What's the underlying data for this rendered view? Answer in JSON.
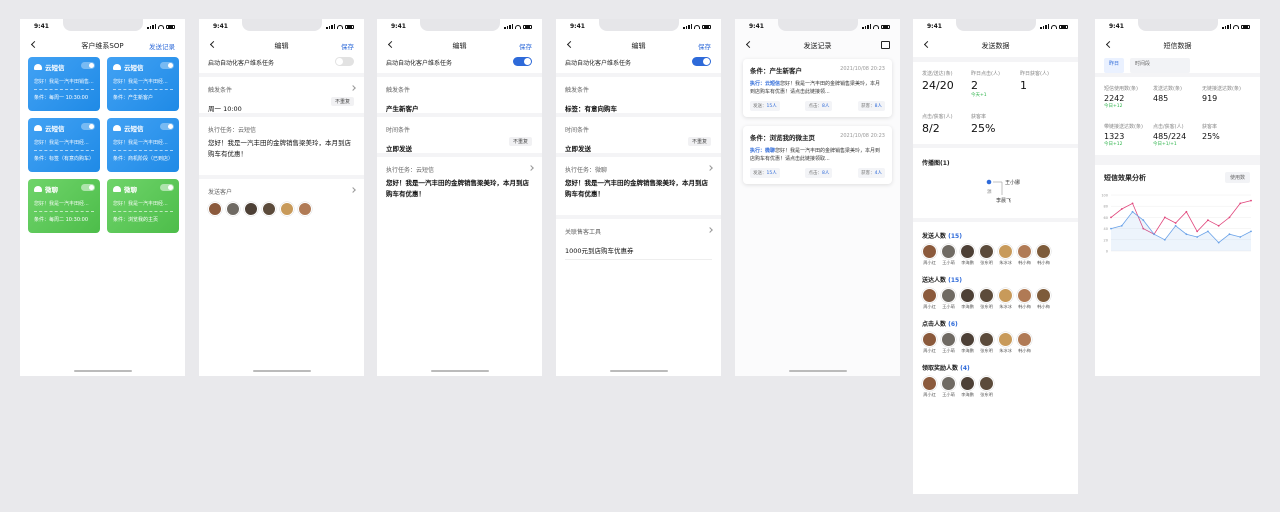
{
  "status": {
    "time": "9:41"
  },
  "s1": {
    "title": "客户维系SOP",
    "right": "发送记录",
    "cards": [
      {
        "name": "云短信",
        "sub": "您好！我是一汽丰田销售...",
        "cond": "条件：每周一 10:30:00",
        "color": "blue",
        "on": false
      },
      {
        "name": "云短信",
        "sub": "您好！我是一汽丰田经...",
        "cond": "条件：产生新客户",
        "color": "blue",
        "on": false
      },
      {
        "name": "云短信",
        "sub": "您好！我是一汽丰田经...",
        "cond": "条件：标签（有意向购车）",
        "color": "blue",
        "on": false
      },
      {
        "name": "云短信",
        "sub": "您好！我是一汽丰田经...",
        "cond": "条件：商机阶段（已到店）",
        "color": "blue",
        "on": false
      },
      {
        "name": "微聊",
        "sub": "您好！我是一汽丰田经...",
        "cond": "条件：每周二 10:30:00",
        "color": "green",
        "on": true
      },
      {
        "name": "微聊",
        "sub": "您好！我是一汽丰田经...",
        "cond": "条件：浏览我的主页",
        "color": "green",
        "on": true
      }
    ]
  },
  "s2": {
    "title": "编辑",
    "save": "保存",
    "toggle_label": "启动自动化客户维系任务",
    "trigger_label": "触发条件",
    "trigger_val": "周一 10:00",
    "repeat": "不重复",
    "task_label": "执行任务：云短信",
    "task_text": "您好！我是一汽丰田的金牌销售梁美玲，本月到店购车有优惠！",
    "cust_label": "发送客户"
  },
  "s3": {
    "title": "编辑",
    "save": "保存",
    "toggle_label": "启动自动化客户维系任务",
    "trigger_label": "触发条件",
    "trigger_val": "产生新客户",
    "time_label": "时间条件",
    "time_val": "立即发送",
    "repeat": "不重复",
    "task_label": "执行任务：云短信",
    "task_text": "您好！我是一汽丰田的金牌销售梁美玲，本月到店购车有优惠！"
  },
  "s4": {
    "title": "编辑",
    "save": "保存",
    "toggle_label": "启动自动化客户维系任务",
    "trigger_label": "触发条件",
    "trigger_val": "标签：有意向购车",
    "time_label": "时间条件",
    "time_val": "立即发送",
    "repeat": "不重复",
    "task_label": "执行任务：微聊",
    "task_text": "您好！我是一汽丰田的金牌销售梁美玲，本月到店购车有优惠！",
    "tool_label": "关联售客工具",
    "tool_val": "1000元到店购车优惠券"
  },
  "s5": {
    "title": "发送记录",
    "records": [
      {
        "title": "条件：产生新客户",
        "time": "2021/10/08 20:23",
        "exec": "执行：",
        "channel": "云短信",
        "body": "您好！我是一汽丰田的金牌销售梁美玲，本月到店购车有优惠！请点击此链接领...",
        "s1": "发送：",
        "v1": "15人",
        "s2": "点击：",
        "v2": "8人",
        "s3": "获客：",
        "v3": "8人"
      },
      {
        "title": "条件：浏览我的微主页",
        "time": "2021/10/08 20:23",
        "exec": "执行：",
        "channel": "微聊",
        "body": "您好！我是一汽丰田的金牌销售梁美玲，本月到店购车有优惠！请点击此链接领取...",
        "s1": "发送：",
        "v1": "15人",
        "s2": "点击：",
        "v2": "8人",
        "s3": "获客：",
        "v3": "4人"
      }
    ]
  },
  "s6": {
    "title": "发送数据",
    "stats": [
      {
        "label": "发送/送达(条)",
        "value": "24/20",
        "inc": ""
      },
      {
        "label": "昨日点击(人)",
        "value": "2",
        "inc": "今天+1"
      },
      {
        "label": "昨日获客(人)",
        "value": "1",
        "inc": ""
      },
      {
        "label": "点击/获客(人)",
        "value": "8/2",
        "inc": ""
      },
      {
        "label": "获客率",
        "value": "25%",
        "inc": ""
      }
    ],
    "spread_title": "传播图(1)",
    "spread_a": "王小娜",
    "spread_src": "源",
    "spread_b": "李晨飞",
    "groups": [
      {
        "title": "发送人数",
        "count": "(15)",
        "people": [
          "周小红",
          "王小萌",
          "李海鹏",
          "张东明",
          "朱冰冰",
          "韩小梅",
          "韩小梅"
        ]
      },
      {
        "title": "送达人数",
        "count": "(15)",
        "people": [
          "周小红",
          "王小萌",
          "李海鹏",
          "张东明",
          "朱冰冰",
          "韩小梅",
          "韩小梅"
        ]
      },
      {
        "title": "点击人数",
        "count": "(6)",
        "people": [
          "周小红",
          "王小萌",
          "李海鹏",
          "张东明",
          "朱冰冰",
          "韩小梅"
        ]
      },
      {
        "title": "领取奖励人数",
        "count": "(4)",
        "people": [
          "周小红",
          "王小萌",
          "李海鹏",
          "张东明"
        ]
      }
    ]
  },
  "s7": {
    "title": "短信数据",
    "f1": "昨日",
    "f2": "时间段",
    "stats": [
      {
        "label": "短信使用数(条)",
        "value": "2242",
        "inc": "今日+12"
      },
      {
        "label": "发送达数(条)",
        "value": "485",
        "inc": ""
      },
      {
        "label": "无链接送达数(条)",
        "value": "919",
        "inc": ""
      },
      {
        "label": "带链接送达数(条)",
        "value": "1323",
        "inc": "今日+12"
      },
      {
        "label": "点击/获客(人)",
        "value": "485/224",
        "inc": "今日+1/+1"
      },
      {
        "label": "获客率",
        "value": "25%",
        "inc": ""
      }
    ],
    "chart_title": "短信效果分析",
    "chart_filter": "使用数",
    "chart_data": {
      "type": "line",
      "x": [
        1,
        2,
        3,
        4,
        5,
        6,
        7,
        8,
        9,
        10,
        11,
        12,
        13,
        14
      ],
      "series": [
        {
          "values": [
            60,
            75,
            85,
            40,
            30,
            60,
            50,
            70,
            35,
            55,
            45,
            60,
            85,
            90
          ],
          "color": "#e0457b"
        },
        {
          "values": [
            40,
            45,
            70,
            55,
            30,
            20,
            45,
            30,
            25,
            35,
            15,
            30,
            25,
            35
          ],
          "color": "#6aa2e8"
        }
      ],
      "ylim": [
        0,
        100
      ],
      "ticks": [
        "100",
        "80",
        "60",
        "40",
        "20",
        "0"
      ]
    }
  }
}
